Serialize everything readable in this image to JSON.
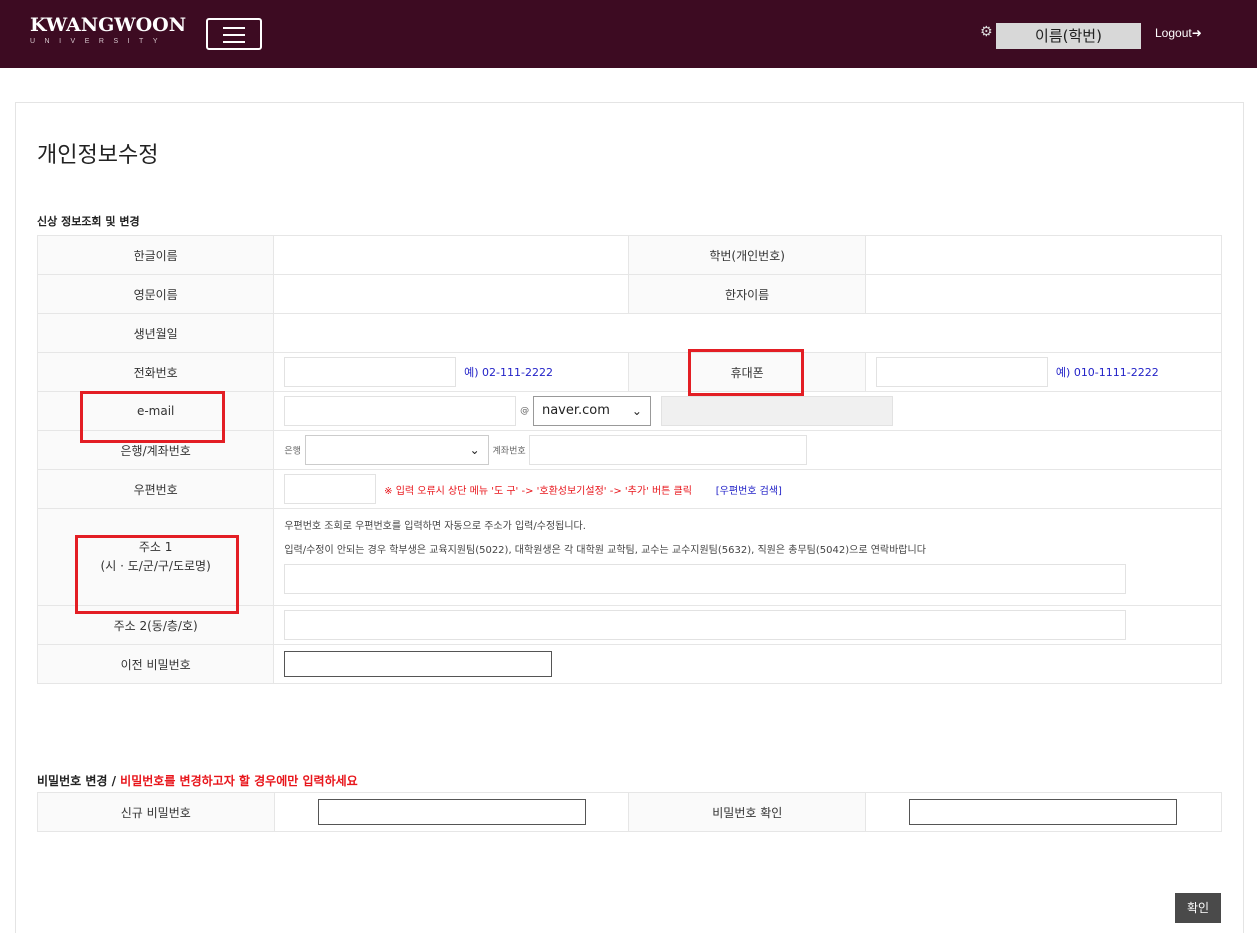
{
  "header": {
    "logo_main": "KWANGWOON",
    "logo_sub": "UNIVERSITY",
    "user": "이름(학번)",
    "logout": "Logout"
  },
  "page": {
    "title": "개인정보수정",
    "section1": "신상 정보조회 및 변경",
    "section2_prefix": "비밀번호 변경 / ",
    "section2_warning": "비밀번호를 변경하고자 할 경우에만 입력하세요"
  },
  "fields": {
    "korean_name": "한글이름",
    "student_id": "학번(개인번호)",
    "english_name": "영문이름",
    "hanja_name": "한자이름",
    "birth": "생년월일",
    "phone": "전화번호",
    "phone_hint": "예) 02-111-2222",
    "mobile": "휴대폰",
    "mobile_hint": "예) 010-1111-2222",
    "email": "e-mail",
    "email_at": "@",
    "email_domain": "naver.com",
    "bank": "은행/계좌번호",
    "bank_inline": "은행",
    "account_inline": "계좌번호",
    "zip": "우편번호",
    "zip_error_note": "※ 입력 오류시 상단 메뉴 '도 구' -> '호환성보기설정' -> '추가' 버튼 클릭",
    "zip_search": "[우편번호 검색]",
    "addr1_line1": "주소 1",
    "addr1_line2": "(시 · 도/군/구/도로명)",
    "addr1_info1": "우편번호 조회로 우편번호를 입력하면 자동으로 주소가 입력/수정됩니다.",
    "addr1_info2": "입력/수정이 안되는 경우 학부생은 교육지원팀(5022), 대학원생은 각 대학원 교학팀, 교수는 교수지원팀(5632), 직원은 총무팀(5042)으로 연락바랍니다",
    "addr2": "주소 2(동/층/호)",
    "prev_password": "이전 비밀번호",
    "new_password": "신규 비밀번호",
    "confirm_password": "비밀번호 확인"
  },
  "buttons": {
    "confirm": "확인"
  },
  "colors": {
    "header_bg": "#3d0b22",
    "highlight_box": "#e31e24",
    "hint_blue": "#2323c8",
    "warning_red": "#e8151b"
  }
}
